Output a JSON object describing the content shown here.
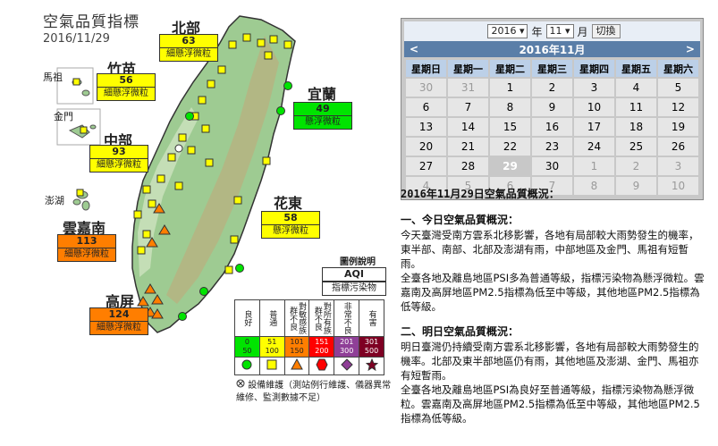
{
  "map": {
    "title": "空氣品質指標",
    "date": "2016/11/29",
    "regions": {
      "north": {
        "name": "北部",
        "aqi": "63",
        "pollutant": "細懸浮微粒",
        "color": "#ffff00"
      },
      "zhumiao": {
        "name": "竹苗",
        "aqi": "56",
        "pollutant": "細懸浮微粒",
        "color": "#ffff00"
      },
      "yilan": {
        "name": "宜蘭",
        "aqi": "49",
        "pollutant": "懸浮微粒",
        "color": "#00e400"
      },
      "central": {
        "name": "中部",
        "aqi": "93",
        "pollutant": "細懸浮微粒",
        "color": "#ffff00"
      },
      "hualien": {
        "name": "花東",
        "aqi": "58",
        "pollutant": "懸浮微粒",
        "color": "#ffff00"
      },
      "yunjianan": {
        "name": "雲嘉南",
        "aqi": "113",
        "pollutant": "細懸浮微粒",
        "color": "#ff7e00"
      },
      "gaoping": {
        "name": "高屏",
        "aqi": "124",
        "pollutant": "細懸浮微粒",
        "color": "#ff7e00"
      }
    },
    "islands": {
      "matsu": "馬祖",
      "kinmen": "金門",
      "penghu": "澎湖"
    }
  },
  "legend": {
    "heading": "圖例說明",
    "box1": "AQI",
    "box2": "指標污染物",
    "categories": [
      "良好",
      "普通",
      "對敏感族群不良",
      "對所有族群不良",
      "非常不良",
      "有害"
    ],
    "ranges": [
      "0\n50",
      "51\n100",
      "101\n150",
      "151\n200",
      "201\n300",
      "301\n500"
    ],
    "colors": [
      "#00e400",
      "#ffff00",
      "#ff7e00",
      "#ff0000",
      "#8f3f97",
      "#7e0023"
    ],
    "note": "設備維護（測站例行維護、儀器異常維修、監測數據不足）"
  },
  "calendar": {
    "year": "2016",
    "year_unit": "年",
    "month": "11",
    "month_unit": "月",
    "switch_label": "切換",
    "header": "2016年11月",
    "prev": "<",
    "next": ">",
    "weekdays": [
      "星期日",
      "星期一",
      "星期二",
      "星期三",
      "星期四",
      "星期五",
      "星期六"
    ],
    "weeks": [
      [
        "30",
        "31",
        "1",
        "2",
        "3",
        "4",
        "5"
      ],
      [
        "6",
        "7",
        "8",
        "9",
        "10",
        "11",
        "12"
      ],
      [
        "13",
        "14",
        "15",
        "16",
        "17",
        "18",
        "19"
      ],
      [
        "20",
        "21",
        "22",
        "23",
        "24",
        "25",
        "26"
      ],
      [
        "27",
        "28",
        "29",
        "30",
        "1",
        "2",
        "3"
      ],
      [
        "4",
        "5",
        "6",
        "7",
        "8",
        "9",
        "10"
      ]
    ],
    "today": "29"
  },
  "report": {
    "title": "2016年11月29日空氣品質概況：",
    "today_heading": "一、今日空氣品質概況：",
    "today_p1": "今天臺灣受南方雲系北移影響，各地有局部較大雨勢發生的機率，東半部、南部、北部及澎湖有雨，中部地區及金門、馬祖有短暫雨。",
    "today_p2": "全臺各地及離島地區PSI多為普通等級，指標污染物為懸浮微粒。雲嘉南及高屏地區PM2.5指標為低至中等級，其他地區PM2.5指標為低等級。",
    "tomorrow_heading": "二、明日空氣品質概況：",
    "tomorrow_p1": "明日臺灣仍持續受南方雲系北移影響，各地有局部較大雨勢發生的機率。北部及東半部地區仍有雨，其他地區及澎湖、金門、馬祖亦有短暫雨。",
    "tomorrow_p2": "全臺各地及離島地區PSI為良好至普通等級，指標污染物為懸浮微粒。雲嘉南及高屏地區PM2.5指標為低至中等級，其他地區PM2.5指標為低等級。"
  }
}
